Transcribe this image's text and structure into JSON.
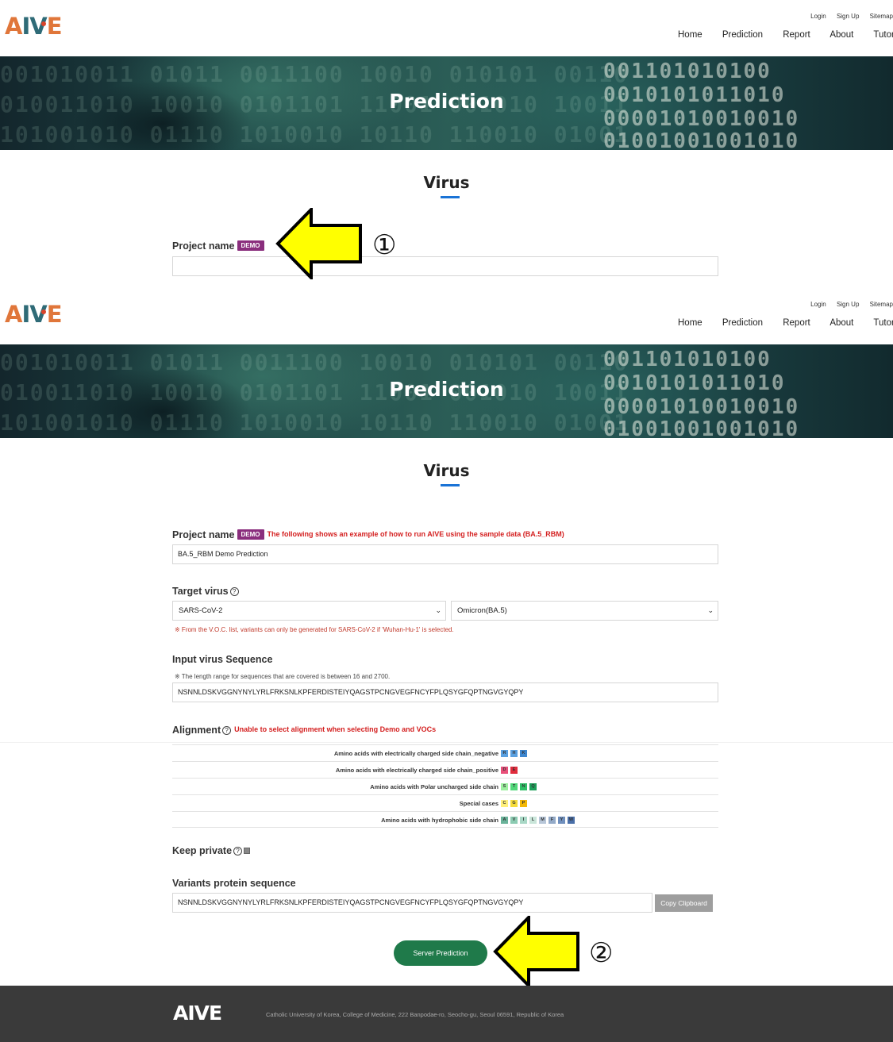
{
  "brand": {
    "logo": "AIVE"
  },
  "util_links": [
    "Login",
    "Sign Up",
    "Sitemap"
  ],
  "nav": [
    "Home",
    "Prediction",
    "Report",
    "About",
    "Tutorial"
  ],
  "banner": {
    "title": "Prediction"
  },
  "section": {
    "title": "Virus"
  },
  "markers": {
    "step1": "①",
    "step2": "②"
  },
  "screen1": {
    "project_label": "Project name",
    "demo_badge": "DEMO",
    "project_value": ""
  },
  "screen2": {
    "project_label": "Project name",
    "demo_badge": "DEMO",
    "demo_note": "The following shows an example of how to run AIVE using the sample data (BA.5_RBM)",
    "project_value": "BA.5_RBM Demo Prediction",
    "target_label": "Target virus",
    "target_virus": "SARS-CoV-2",
    "variant": "Omicron(BA.5)",
    "target_note": "※ From the V.O.C. list, variants can only be generated for SARS-CoV-2 if 'Wuhan-Hu-1' is selected.",
    "sequence_label": "Input virus Sequence",
    "sequence_note": "※ The length range for sequences that are covered is between 16 and 2700.",
    "sequence_value": "NSNNLDSKVGGNYNYLYRLFRKSNLKPFERDISTEIYQAGSTPCNGVEGFNCYFPLQSYGFQPTNGVGYQPY",
    "alignment_label": "Alignment",
    "alignment_note": "Unable to select alignment when selecting Demo and VOCs",
    "amino_groups": [
      {
        "label": "Amino acids with electrically charged side chain_negative",
        "residues": [
          "R",
          "H",
          "K"
        ],
        "colors": [
          "#5aa0e0",
          "#5aa0e0",
          "#3d86cf"
        ]
      },
      {
        "label": "Amino acids with electrically charged side chain_positive",
        "residues": [
          "D",
          "E"
        ],
        "colors": [
          "#e9507a",
          "#e02b3c"
        ]
      },
      {
        "label": "Amino acids with Polar uncharged side chain",
        "residues": [
          "S",
          "T",
          "N",
          "Q"
        ],
        "colors": [
          "#9df0a0",
          "#52d87a",
          "#2fc067",
          "#1da05a"
        ]
      },
      {
        "label": "Special cases",
        "residues": [
          "C",
          "G",
          "P"
        ],
        "colors": [
          "#fff07a",
          "#f5dc3b",
          "#f2b705"
        ]
      },
      {
        "label": "Amino acids with hydrophobic side chain",
        "residues": [
          "A",
          "V",
          "I",
          "L",
          "M",
          "F",
          "Y",
          "W"
        ],
        "colors": [
          "#6ab39a",
          "#8ccbb2",
          "#a9d8c6",
          "#c9e5d9",
          "#b7c6d8",
          "#93aac8",
          "#6f8fbd",
          "#4a6fa8"
        ]
      }
    ],
    "keep_private_label": "Keep private",
    "variants_label": "Variants protein sequence",
    "variants_value": "NSNNLDSKVGGNYNYLYRLFRKSNLKPFERDISTEIYQAGSTPCNGVEGFNCYFPLQSYGFQPTNGVGYQPY",
    "copy_button": "Copy Clipboard",
    "server_button": "Server Prediction"
  },
  "footer": {
    "logo": "AIVE",
    "address": "Catholic University of Korea, College of Medicine, 222 Banpodae-ro, Seocho-gu, Seoul 06591, Republic of Korea"
  },
  "colors": {
    "demo_badge": "#8a2e7d",
    "accent_line": "#1a73d6",
    "server_button": "#1f7a4a",
    "arrow": "#ffff00",
    "footer_bg": "#3a3a3a"
  }
}
